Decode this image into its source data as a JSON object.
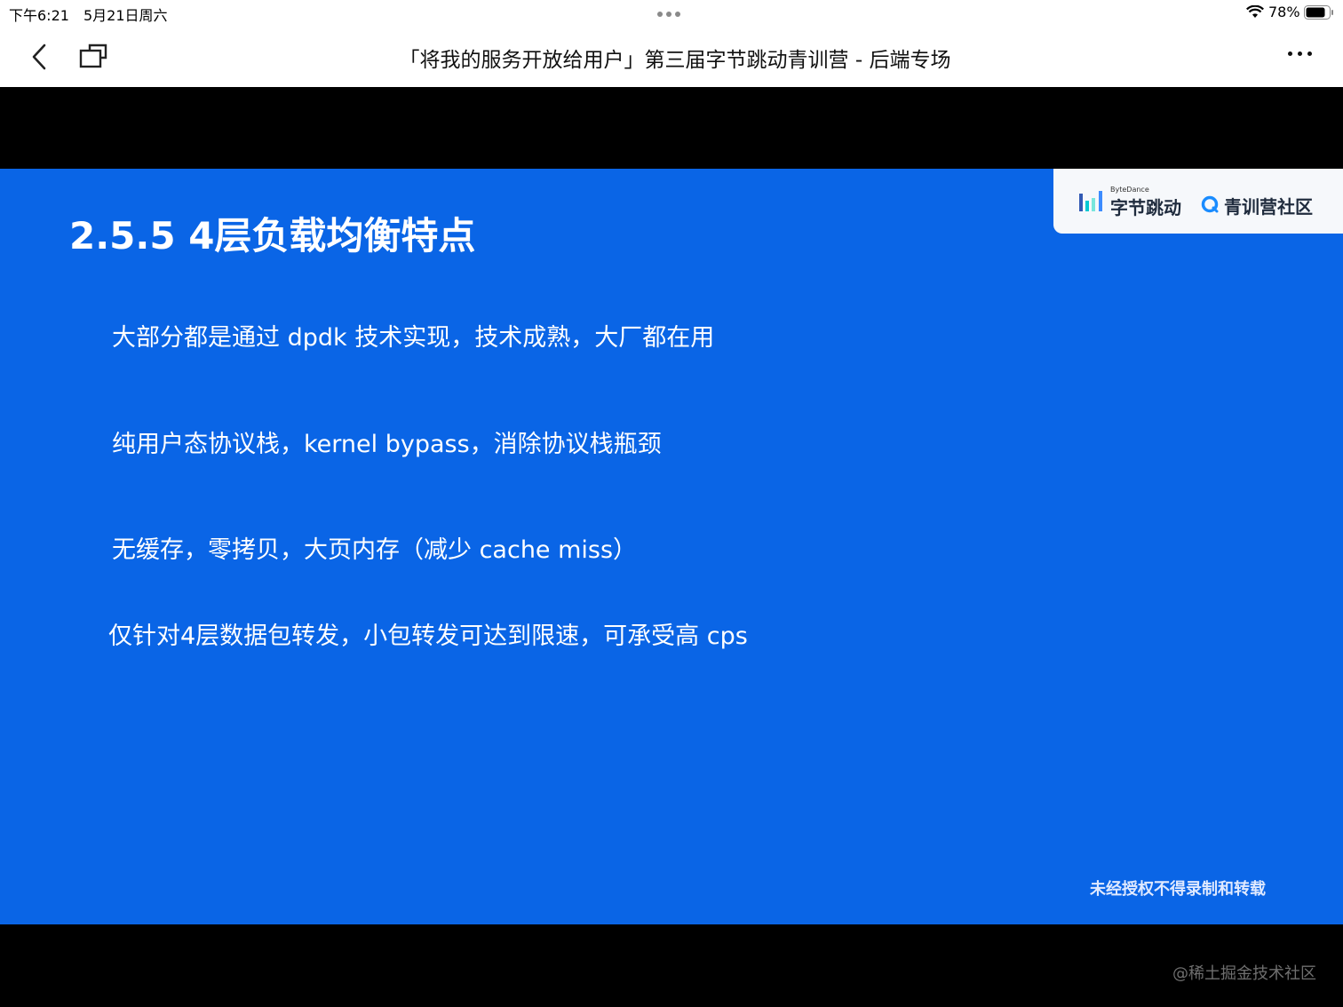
{
  "status_bar": {
    "time": "下午6:21",
    "date": "5月21日周六",
    "battery": "78%"
  },
  "nav": {
    "title": "「将我的服务开放给用户」第三届字节跳动青训营 - 后端专场"
  },
  "slide": {
    "title": "2.5.5 4层负载均衡特点",
    "bullets": [
      "大部分都是通过 dpdk 技术实现，技术成熟，大厂都在用",
      "纯用户态协议栈，kernel bypass，消除协议栈瓶颈",
      "无缓存，零拷贝，大页内存（减少 cache miss）",
      "仅针对4层数据包转发，小包转发可达到限速，可承受高 cps"
    ],
    "logo_small": "ByteDance",
    "logo_bytedance": "字节跳动",
    "logo_community": "青训营社区",
    "copyright": "未经授权不得录制和转载"
  },
  "watermark": "@稀土掘金技术社区",
  "colors": {
    "slide_bg": "#0a65e6",
    "accent": "#1a8cff"
  }
}
